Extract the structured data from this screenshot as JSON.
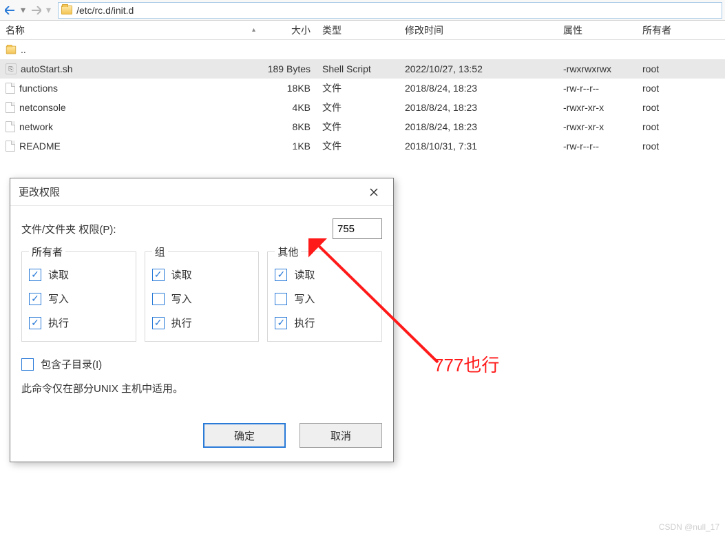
{
  "path": "/etc/rc.d/init.d",
  "columns": {
    "name": "名称",
    "size": "大小",
    "type": "类型",
    "modified": "修改时间",
    "attr": "属性",
    "owner": "所有者"
  },
  "parent_row": "..",
  "files": [
    {
      "name": "autoStart.sh",
      "size": "189 Bytes",
      "type": "Shell Script",
      "modified": "2022/10/27, 13:52",
      "attr": "-rwxrwxrwx",
      "owner": "root",
      "icon": "sh",
      "selected": true
    },
    {
      "name": "functions",
      "size": "18KB",
      "type": "文件",
      "modified": "2018/8/24, 18:23",
      "attr": "-rw-r--r--",
      "owner": "root",
      "icon": "file"
    },
    {
      "name": "netconsole",
      "size": "4KB",
      "type": "文件",
      "modified": "2018/8/24, 18:23",
      "attr": "-rwxr-xr-x",
      "owner": "root",
      "icon": "file"
    },
    {
      "name": "network",
      "size": "8KB",
      "type": "文件",
      "modified": "2018/8/24, 18:23",
      "attr": "-rwxr-xr-x",
      "owner": "root",
      "icon": "file"
    },
    {
      "name": "README",
      "size": "1KB",
      "type": "文件",
      "modified": "2018/10/31, 7:31",
      "attr": "-rw-r--r--",
      "owner": "root",
      "icon": "file"
    }
  ],
  "dialog": {
    "title": "更改权限",
    "field_label": "文件/文件夹 权限(P):",
    "value": "755",
    "groups": {
      "owner": {
        "title": "所有者",
        "read": true,
        "write": true,
        "exec": true
      },
      "group": {
        "title": "组",
        "read": true,
        "write": false,
        "exec": true
      },
      "other": {
        "title": "其他",
        "read": true,
        "write": false,
        "exec": true
      }
    },
    "perm_labels": {
      "read": "读取",
      "write": "写入",
      "exec": "执行"
    },
    "include_sub": {
      "checked": false,
      "label": "包含子目录(I)"
    },
    "note": "此命令仅在部分UNIX 主机中适用。",
    "ok": "确定",
    "cancel": "取消"
  },
  "annotation": "777也行",
  "watermark": "CSDN @null_17"
}
